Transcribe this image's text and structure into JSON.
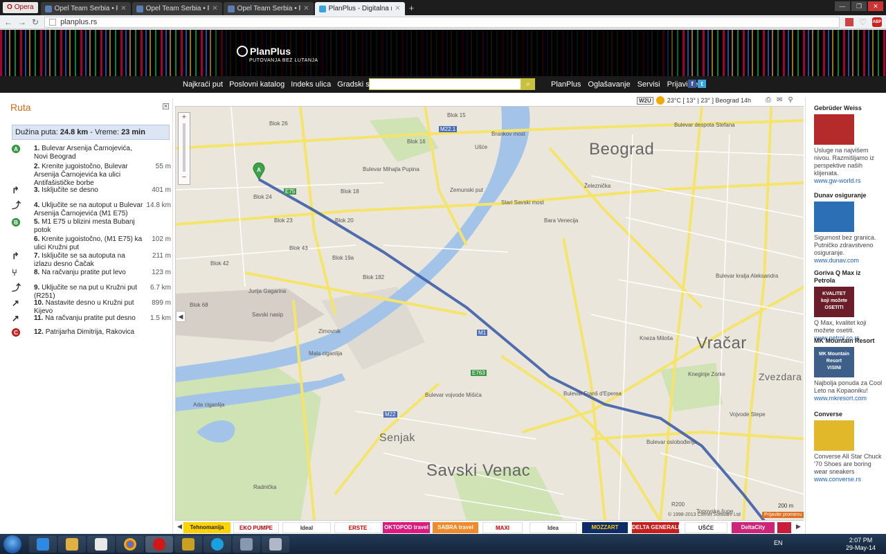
{
  "browser": {
    "opera_label": "Opera",
    "tabs": [
      {
        "title": "Opel Team Serbia • Pogled..."
      },
      {
        "title": "Opel Team Serbia • Pogled..."
      },
      {
        "title": "Opel Team Serbia • Pošalji..."
      },
      {
        "title": "PlanPlus - Digitalna mapa..."
      }
    ],
    "url": "planplus.rs"
  },
  "site": {
    "logo_name": "PlanPlus",
    "logo_tagline": "PUTOVANJA BEZ LUTANJA",
    "nav_left": [
      "Najkraći put",
      "Poslovni katalog",
      "Indeks ulica",
      "Gradski saobraćaj"
    ],
    "nav_right": [
      "PlanPlus",
      "Oglašavanje",
      "Servisi",
      "Prijavi se"
    ],
    "search_placeholder": ""
  },
  "route": {
    "title": "Ruta",
    "summary_prefix": "Dužina puta: ",
    "length": "24.8 km",
    "summary_mid": " - Vreme: ",
    "time": "23 min",
    "steps": [
      {
        "n": "1.",
        "text": "Bulevar Arsenija Čarnojevića, Novi Beograd",
        "dist": "",
        "icon": "pin-a"
      },
      {
        "n": "2.",
        "text": "Krenite jugoistočno, Bulevar Arsenija Čarnojevića ka ulici Antifašističke borbe",
        "dist": "55 m",
        "icon": "none"
      },
      {
        "n": "3.",
        "text": "Isključite se desno",
        "dist": "401 m",
        "icon": "turn-right"
      },
      {
        "n": "4.",
        "text": "Uključite se na autoput u Bulevar Arsenija Čarnojevića (M1 E75)",
        "dist": "14.8 km",
        "icon": "merge"
      },
      {
        "n": "5.",
        "text": "M1 E75 u blizini mesta Bubanj potok",
        "dist": "",
        "icon": "pin-b"
      },
      {
        "n": "6.",
        "text": "Krenite jugoistočno, (M1 E75) ka ulici Kružni put",
        "dist": "102 m",
        "icon": "none"
      },
      {
        "n": "7.",
        "text": "Isključite se sa autoputa na izlazu desno Čačak",
        "dist": "211 m",
        "icon": "turn-right"
      },
      {
        "n": "8.",
        "text": "Na račvanju pratite put levo",
        "dist": "123 m",
        "icon": "fork"
      },
      {
        "n": "9.",
        "text": "Uključite se na put u Kružni put (R251)",
        "dist": "6.7 km",
        "icon": "merge"
      },
      {
        "n": "10.",
        "text": "Nastavite desno u Kružni put Kijevo",
        "dist": "899 m",
        "icon": "bear-right"
      },
      {
        "n": "11.",
        "text": "Na račvanju pratite put desno",
        "dist": "1.5 km",
        "icon": "fork-right"
      },
      {
        "n": "12.",
        "text": "Patrijarha Dimitrija, Rakovica",
        "dist": "",
        "icon": "pin-c"
      }
    ]
  },
  "map": {
    "weather_provider": "W2U",
    "weather": "23°C [ 13° | 23° ] Beograd 14h",
    "district_labels": [
      "Beograd",
      "Vračar",
      "Savski Venac",
      "Senjak",
      "Zvezdara"
    ],
    "labels": [
      "Blok 26",
      "Blok 15",
      "Blok 16",
      "Blok 24",
      "Blok 23",
      "Blok 43",
      "Blok 42",
      "Blok 19a",
      "Blok 20",
      "Blok 18",
      "Blok 68",
      "Blok 182",
      "Ušće",
      "Brankov most",
      "Zemunski put",
      "Bulevar Mihajla Pupina",
      "Savski nasip",
      "Jurija Gagarina",
      "Bara Venecija",
      "Mala ciganlija",
      "Ada ciganlija",
      "Zimovnik",
      "Bulevar despota Stefana",
      "Bulevar kralja Aleksandra",
      "Bulevar vojvode Mišića",
      "Kneza Miloša",
      "Bulevar oslobođenja",
      "Radnička",
      "Kneginje Zorke",
      "Stari Savski most",
      "Topovske šupe",
      "Bulevar Franš d'Eperea",
      "Železnička",
      "Vojvode Stepe",
      "M22.1",
      "E75",
      "M1",
      "E763",
      "M22",
      "R200"
    ],
    "scale": "200 m",
    "copyright": "© 1998-2013 Cornet Software Ltd",
    "report_label": "Prijavite promenu",
    "route_color": "#3e5fa8",
    "water_color": "#a3c4e8",
    "road_color": "#f5e46b"
  },
  "ads_strip": [
    "Tehnomanija",
    "EKO PUMPE",
    "Ideal",
    "ERSTE",
    "OKTOPOD travel",
    "SABRA travel",
    "MAXI",
    "Idea",
    "MOZZART",
    "DELTA GENERALI",
    "UŠĆE",
    "DeltaCity"
  ],
  "sidebar_ads": [
    {
      "title": "Gebrüder Weiss",
      "desc": "Usluge na najvišem nivou. Razmišljamo iz perspektive naših klijenata.",
      "url": "www.gw-world.rs",
      "img_color": "#b52a2a"
    },
    {
      "title": "Dunav osiguranje",
      "desc": "Sigurnost bez granica. Putničko zdravstveno osiguranje.",
      "url": "www.dunav.com",
      "img_color": "#2d6fb5"
    },
    {
      "title": "Goriva Q Max iz Petrola",
      "desc": "Q Max, kvalitet koji možete osetiti.",
      "url": "www.petrol.co.rs",
      "img_color": "#6b1e2a",
      "img_text": [
        "KVALITET",
        "koji možete",
        "OSETITI"
      ]
    },
    {
      "title": "MK Mountain Resort",
      "desc": "Najbolja ponuda za Cool Leto na Kopaoniku!",
      "url": "www.mkresort.com",
      "img_color": "#3d5f8a",
      "img_text": [
        "MK Mountain Resort",
        "VISINI"
      ]
    },
    {
      "title": "Converse",
      "desc": "Converse All Star Chuck '70 Shoes are boring wear sneakers",
      "url": "www.converse.rs",
      "img_color": "#e0b82a"
    }
  ],
  "taskbar": {
    "lang": "EN",
    "time": "2:07 PM",
    "date": "29-May-14"
  }
}
